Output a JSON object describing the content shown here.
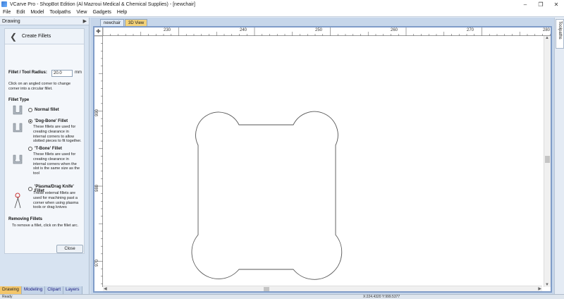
{
  "window": {
    "title": "VCarve Pro - ShopBot Edition (Al Mazroui Medical & Chemical Supplies) - [newchair]"
  },
  "menu": [
    "File",
    "Edit",
    "Model",
    "Toolpaths",
    "View",
    "Gadgets",
    "Help"
  ],
  "left_panel": {
    "header": "Drawing",
    "form_title": "Create Fillets",
    "radius_label": "Fillet / Tool Radius:",
    "radius_value": "20.0",
    "radius_unit": "mm",
    "help_text": "Click on an angled corner to change corner into a circular fillet.",
    "fillet_type_label": "Fillet Type",
    "options": [
      {
        "label": "Normal fillet",
        "desc": "",
        "selected": false
      },
      {
        "label": "'Dog-Bone' Fillet",
        "desc": "These fillets are used for creating clearance in internal corners to allow slotted pieces to fit together.",
        "selected": true
      },
      {
        "label": "'T-Bone' Fillet",
        "desc": "These fillets are used for creating clearance in internal corners when the slot is the same size as the tool",
        "selected": false
      },
      {
        "label": "'Plasma/Drag Knife' Fillet",
        "desc": "These external fillets are used for machining past a corner when using plasma tools or drag knives",
        "selected": false
      }
    ],
    "removing_label": "Removing Fillets",
    "removing_text": "To remove a fillet, click on the fillet arc.",
    "close_label": "Close"
  },
  "bottom_tabs": [
    "Drawing",
    "Modeling",
    "Clipart",
    "Layers"
  ],
  "doc_tabs": {
    "file": "newchair",
    "view3d": "3D View"
  },
  "ruler": {
    "x_labels": [
      "230",
      "240",
      "250",
      "260",
      "270",
      "280"
    ],
    "y_labels": [
      "990",
      "980",
      "970"
    ]
  },
  "right_strip": {
    "label": "Toolpaths"
  },
  "status": {
    "left": "Ready",
    "coords": "X:224.4320 Y:999.5377"
  }
}
